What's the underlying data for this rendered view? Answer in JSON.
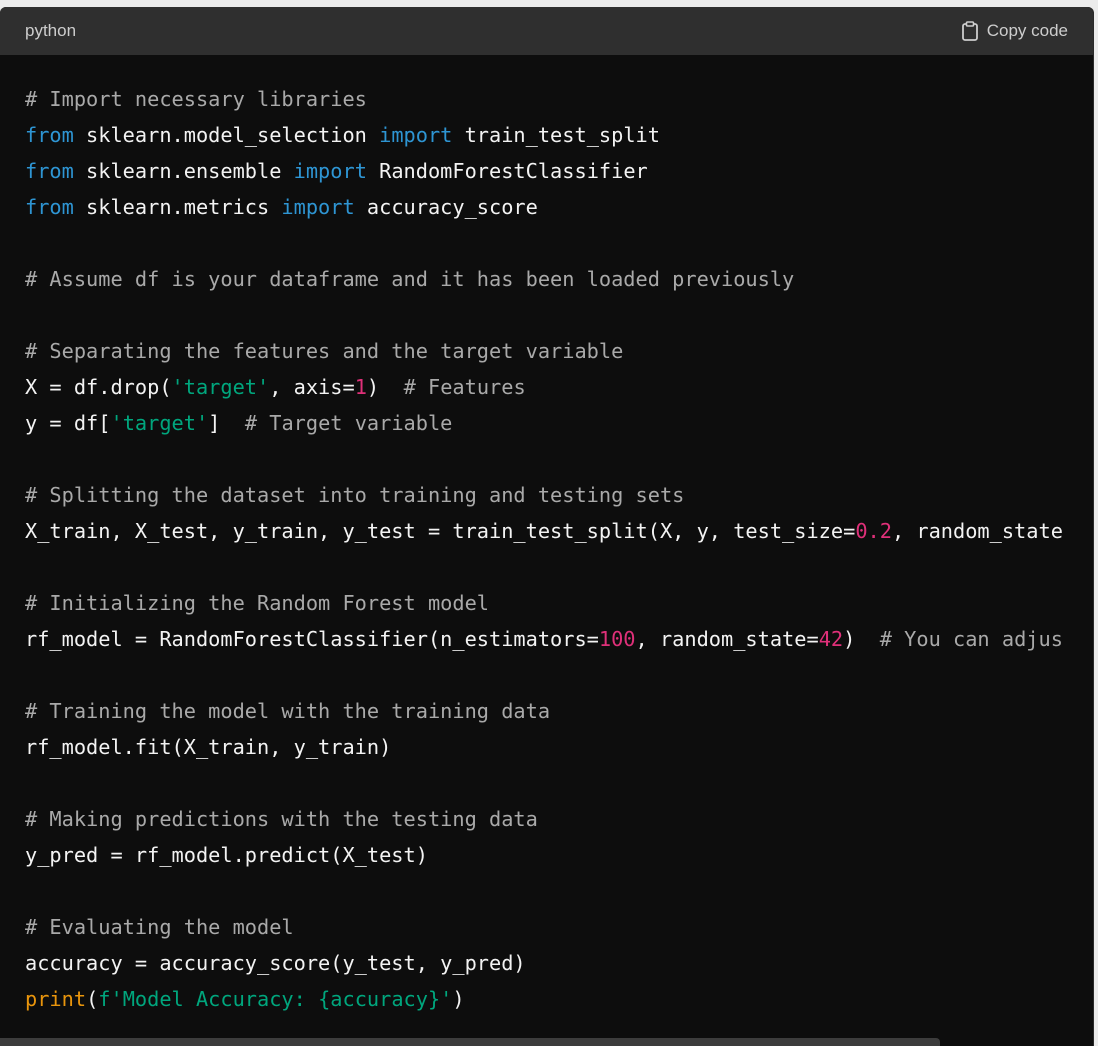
{
  "header": {
    "language": "python",
    "copy_label": "Copy code",
    "copy_icon": "clipboard-icon"
  },
  "code": {
    "lines": [
      [
        {
          "t": "# Import necessary libraries",
          "c": "cm"
        }
      ],
      [
        {
          "t": "from",
          "c": "kw"
        },
        {
          "t": " sklearn.model_selection ",
          "c": ""
        },
        {
          "t": "import",
          "c": "kw"
        },
        {
          "t": " train_test_split",
          "c": ""
        }
      ],
      [
        {
          "t": "from",
          "c": "kw"
        },
        {
          "t": " sklearn.ensemble ",
          "c": ""
        },
        {
          "t": "import",
          "c": "kw"
        },
        {
          "t": " RandomForestClassifier",
          "c": ""
        }
      ],
      [
        {
          "t": "from",
          "c": "kw"
        },
        {
          "t": " sklearn.metrics ",
          "c": ""
        },
        {
          "t": "import",
          "c": "kw"
        },
        {
          "t": " accuracy_score",
          "c": ""
        }
      ],
      [],
      [
        {
          "t": "# Assume df is your dataframe and it has been loaded previously",
          "c": "cm"
        }
      ],
      [],
      [
        {
          "t": "# Separating the features and the target variable",
          "c": "cm"
        }
      ],
      [
        {
          "t": "X = df.drop(",
          "c": ""
        },
        {
          "t": "'target'",
          "c": "str"
        },
        {
          "t": ", axis=",
          "c": ""
        },
        {
          "t": "1",
          "c": "num"
        },
        {
          "t": ")  ",
          "c": ""
        },
        {
          "t": "# Features",
          "c": "cm"
        }
      ],
      [
        {
          "t": "y = df[",
          "c": ""
        },
        {
          "t": "'target'",
          "c": "str"
        },
        {
          "t": "]  ",
          "c": ""
        },
        {
          "t": "# Target variable",
          "c": "cm"
        }
      ],
      [],
      [
        {
          "t": "# Splitting the dataset into training and testing sets",
          "c": "cm"
        }
      ],
      [
        {
          "t": "X_train, X_test, y_train, y_test = train_test_split(X, y, test_size=",
          "c": ""
        },
        {
          "t": "0.2",
          "c": "num"
        },
        {
          "t": ", random_state",
          "c": ""
        }
      ],
      [],
      [
        {
          "t": "# Initializing the Random Forest model",
          "c": "cm"
        }
      ],
      [
        {
          "t": "rf_model = RandomForestClassifier(n_estimators=",
          "c": ""
        },
        {
          "t": "100",
          "c": "num"
        },
        {
          "t": ", random_state=",
          "c": ""
        },
        {
          "t": "42",
          "c": "num"
        },
        {
          "t": ")  ",
          "c": ""
        },
        {
          "t": "# You can adjus",
          "c": "cm"
        }
      ],
      [],
      [
        {
          "t": "# Training the model with the training data",
          "c": "cm"
        }
      ],
      [
        {
          "t": "rf_model.fit(X_train, y_train)",
          "c": ""
        }
      ],
      [],
      [
        {
          "t": "# Making predictions with the testing data",
          "c": "cm"
        }
      ],
      [
        {
          "t": "y_pred = rf_model.predict(X_test)",
          "c": ""
        }
      ],
      [],
      [
        {
          "t": "# Evaluating the model",
          "c": "cm"
        }
      ],
      [
        {
          "t": "accuracy = accuracy_score(y_test, y_pred)",
          "c": ""
        }
      ],
      [
        {
          "t": "print",
          "c": "builtin"
        },
        {
          "t": "(",
          "c": ""
        },
        {
          "t": "f'Model Accuracy: {accuracy}'",
          "c": "str"
        },
        {
          "t": ")",
          "c": ""
        }
      ]
    ]
  },
  "colors": {
    "background": "#0d0d0d",
    "header": "#2f2f2f",
    "keyword": "#2e95d3",
    "string": "#00a67d",
    "number": "#df3079",
    "comment": "#a9a9a9",
    "builtin": "#e9950c"
  }
}
